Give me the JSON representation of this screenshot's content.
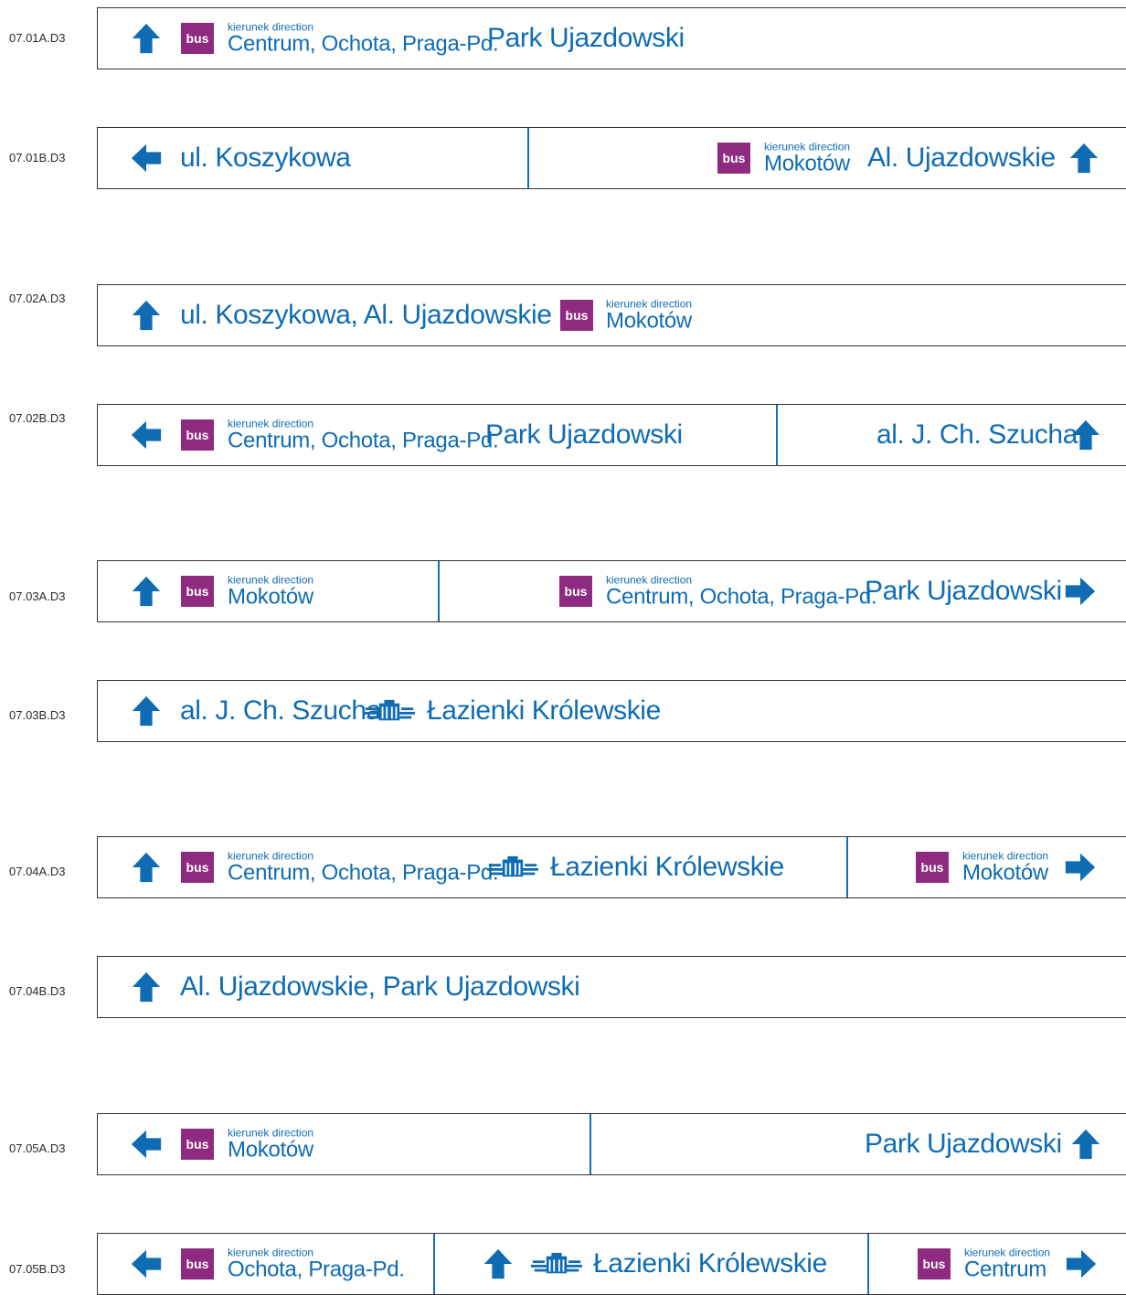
{
  "bus_label": "bus",
  "dir_label": "kierunek direction",
  "colors": {
    "accent_blue": "#0f6cb3",
    "bus_purple": "#8e2a7f",
    "border": "#333333"
  },
  "icons": [
    "arrow-up-icon",
    "arrow-left-icon",
    "arrow-right-icon",
    "palace-icon"
  ],
  "signs": {
    "s1a": {
      "code": "07.01A.D3",
      "dest1": "Centrum, Ochota, Praga-Pd.",
      "text1": "Park Ujazdowski"
    },
    "s1b": {
      "code": "07.01B.D3",
      "text1": "ul. Koszykowa",
      "dest1": "Mokotów",
      "text2": "Al. Ujazdowskie"
    },
    "s2a": {
      "code": "07.02A.D3",
      "text1": "ul. Koszykowa,  Al. Ujazdowskie",
      "dest1": "Mokotów"
    },
    "s2b": {
      "code": "07.02B.D3",
      "dest1": "Centrum, Ochota, Praga-Pd.",
      "text1": "Park Ujazdowski",
      "text2": "al. J. Ch. Szucha"
    },
    "s3a": {
      "code": "07.03A.D3",
      "dest1": "Mokotów",
      "dest2": "Centrum, Ochota, Praga-Pd.",
      "text1": "Park Ujazdowski"
    },
    "s3b": {
      "code": "07.03B.D3",
      "text1": "al. J. Ch. Szucha",
      "text2": "Łazienki Królewskie"
    },
    "s4a": {
      "code": "07.04A.D3",
      "dest1": "Centrum, Ochota, Praga-Pd.",
      "text1": "Łazienki Królewskie",
      "dest2": "Mokotów"
    },
    "s4b": {
      "code": "07.04B.D3",
      "text1": "Al. Ujazdowskie,  Park Ujazdowski"
    },
    "s5a": {
      "code": "07.05A.D3",
      "dest1": "Mokotów",
      "text1": "Park Ujazdowski"
    },
    "s5b": {
      "code": "07.05B.D3",
      "dest1": "Ochota, Praga-Pd.",
      "text1": "Łazienki Królewskie",
      "dest2": "Centrum"
    }
  }
}
